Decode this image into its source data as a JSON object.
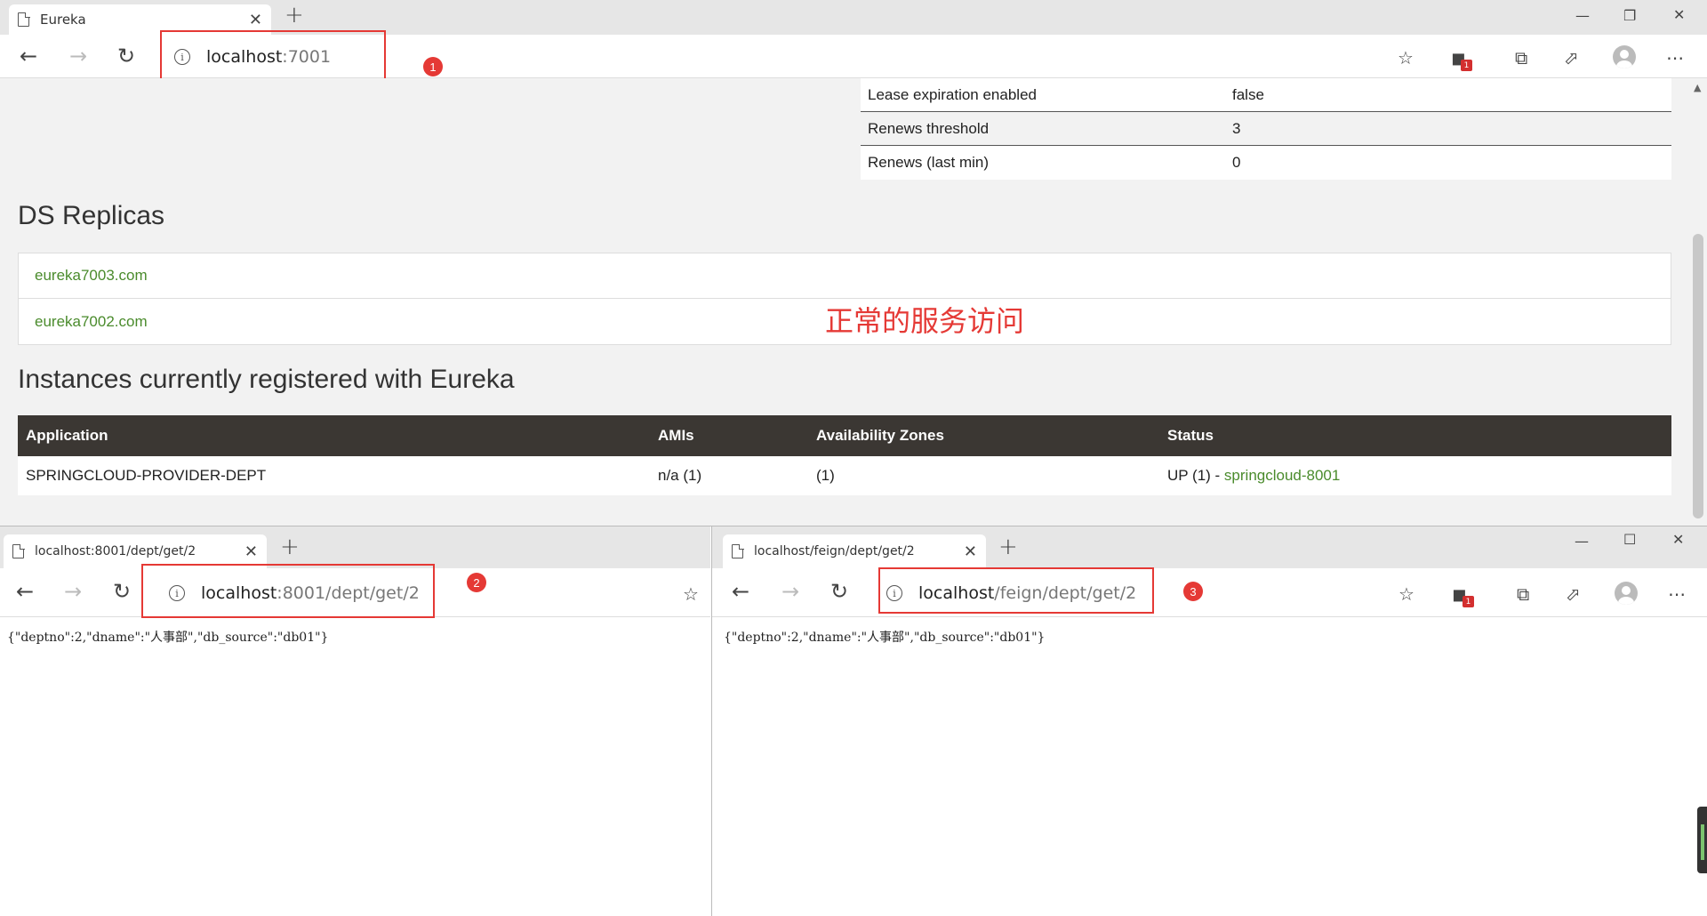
{
  "top_window": {
    "tab_title": "Eureka",
    "address": {
      "host": "localhost",
      "path": ":7001"
    },
    "callout": "1",
    "ext_badge": "1"
  },
  "eureka": {
    "kv_rows": [
      {
        "key": "Lease expiration enabled",
        "value": "false"
      },
      {
        "key": "Renews threshold",
        "value": "3"
      },
      {
        "key": "Renews (last min)",
        "value": "0"
      }
    ],
    "replicas_title": "DS Replicas",
    "replicas": [
      "eureka7003.com",
      "eureka7002.com"
    ],
    "annotation": "正常的服务访问",
    "instances_title": "Instances currently registered with Eureka",
    "instances_headers": [
      "Application",
      "AMIs",
      "Availability Zones",
      "Status"
    ],
    "instances_rows": [
      {
        "application": "SPRINGCLOUD-PROVIDER-DEPT",
        "amis": "n/a (1)",
        "zones": "(1)",
        "status_prefix": "UP (1) - ",
        "status_link": "springcloud-8001"
      }
    ]
  },
  "left_window": {
    "tab_title": "localhost:8001/dept/get/2",
    "address": {
      "host": "localhost",
      "path": ":8001/dept/get/2"
    },
    "callout": "2",
    "json": "{\"deptno\":2,\"dname\":\"人事部\",\"db_source\":\"db01\"}"
  },
  "right_window": {
    "tab_title": "localhost/feign/dept/get/2",
    "address": {
      "host": "localhost",
      "path": "/feign/dept/get/2"
    },
    "callout": "3",
    "ext_badge": "1",
    "json": "{\"deptno\":2,\"dname\":\"人事部\",\"db_source\":\"db01\"}"
  },
  "colors": {
    "link_green": "#4a8b2c",
    "annotation_red": "#e53935",
    "table_header": "#3b3733"
  }
}
